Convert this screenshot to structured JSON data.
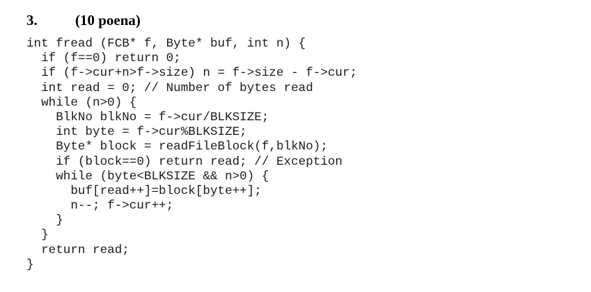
{
  "problem": {
    "number": "3.",
    "points": "(10 poena)"
  },
  "code": {
    "lines": [
      "int fread (FCB* f, Byte* buf, int n) {",
      "  if (f==0) return 0;",
      "  if (f->cur+n>f->size) n = f->size - f->cur;",
      "  int read = 0; // Number of bytes read",
      "  while (n>0) {",
      "    BlkNo blkNo = f->cur/BLKSIZE;",
      "    int byte = f->cur%BLKSIZE;",
      "    Byte* block = readFileBlock(f,blkNo);",
      "    if (block==0) return read; // Exception",
      "    while (byte<BLKSIZE && n>0) {",
      "      buf[read++]=block[byte++];",
      "      n--; f->cur++;",
      "    }",
      "  }",
      "  return read;",
      "}"
    ]
  }
}
